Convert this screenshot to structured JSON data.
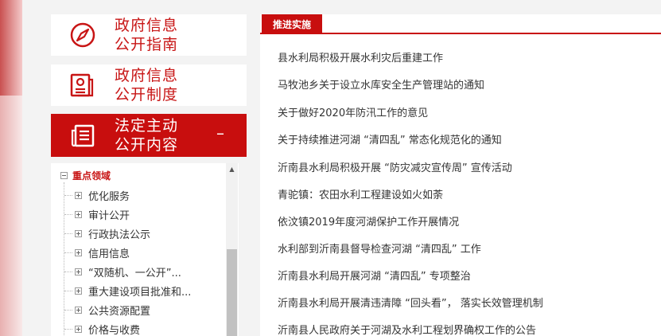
{
  "sidebar": {
    "cards": [
      {
        "label_line1": "政府信息",
        "label_line2": "公开指南",
        "icon": "compass-icon"
      },
      {
        "label_line1": "政府信息",
        "label_line2": "公开制度",
        "icon": "document-regulation-icon"
      },
      {
        "label_line1": "法定主动",
        "label_line2": "公开内容",
        "icon": "newspaper-icon",
        "toggle": "–"
      }
    ],
    "tree": {
      "root": "重点领域",
      "items": [
        {
          "label": "优化服务"
        },
        {
          "label": "审计公开"
        },
        {
          "label": "行政执法公示"
        },
        {
          "label": "信用信息"
        },
        {
          "label": "“双随机、一公开”..."
        },
        {
          "label": "重大建设项目批准和..."
        },
        {
          "label": "公共资源配置"
        },
        {
          "label": "价格与收费"
        }
      ]
    },
    "scroll_up_icon": "▲"
  },
  "main": {
    "tab_label": "推进实施",
    "items": [
      "县水利局积极开展水利灾后重建工作",
      "马牧池乡关于设立水库安全生产管理站的通知",
      "关于做好2020年防汛工作的意见",
      "关于持续推进河湖 “清四乱” 常态化规范化的通知",
      "沂南县水利局积极开展 “防灾减灾宣传周” 宣传活动",
      "青驼镇：农田水利工程建设如火如荼",
      "依汶镇2019年度河湖保护工作开展情况",
      "水利部到沂南县督导检查河湖 “清四乱” 工作",
      "沂南县水利局开展河湖 “清四乱” 专项整治",
      "沂南县水利局开展清违清障 “回头看”， 落实长效管理机制",
      "沂南县人民政府关于河湖及水利工程划界确权工作的公告"
    ]
  },
  "colors": {
    "brand_red": "#c80e0e",
    "text_dark": "#333333"
  }
}
